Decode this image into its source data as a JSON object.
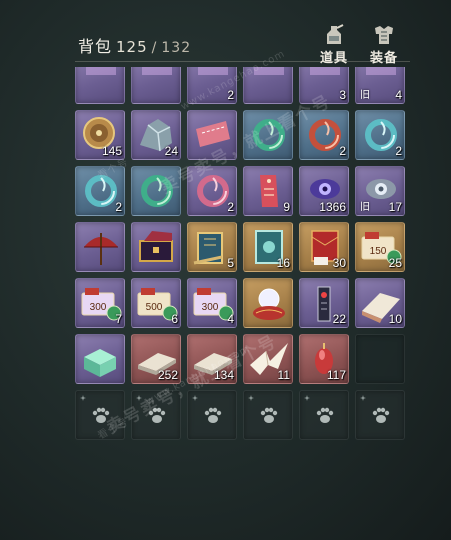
{
  "header": {
    "title": "背包",
    "count": "125",
    "capacity": "132",
    "tabs": [
      {
        "label": "道具",
        "icon": "bottle-icon"
      },
      {
        "label": "装备",
        "icon": "armor-icon"
      }
    ]
  },
  "watermark": {
    "line1": "卖号卖号，就上看个号",
    "url": "www.kangehao.com",
    "small": "看个号"
  },
  "colors": {
    "purple": "#6b5e92",
    "blue": "#4e6e88",
    "gold": "#a47e48",
    "red": "#8c5252"
  },
  "slots": [
    {
      "rarity": "purple",
      "icon": "partial-item-icon",
      "qty": "",
      "old": ""
    },
    {
      "rarity": "purple",
      "icon": "partial-item-icon",
      "qty": "",
      "old": ""
    },
    {
      "rarity": "purple",
      "icon": "partial-item-icon",
      "qty": "2",
      "old": ""
    },
    {
      "rarity": "purple",
      "icon": "partial-item-icon",
      "qty": "",
      "old": ""
    },
    {
      "rarity": "purple",
      "icon": "partial-item-icon",
      "qty": "3",
      "old": ""
    },
    {
      "rarity": "purple",
      "icon": "partial-item-icon",
      "qty": "4",
      "old": "旧"
    },
    {
      "rarity": "purple",
      "icon": "compass-icon",
      "qty": "145",
      "old": ""
    },
    {
      "rarity": "purple",
      "icon": "ore-icon",
      "qty": "24",
      "old": ""
    },
    {
      "rarity": "purple",
      "icon": "ticket-icon",
      "qty": "",
      "old": ""
    },
    {
      "rarity": "blue",
      "icon": "green-ring-icon",
      "qty": "",
      "old": ""
    },
    {
      "rarity": "blue",
      "icon": "red-ring-icon",
      "qty": "2",
      "old": ""
    },
    {
      "rarity": "blue",
      "icon": "cyan-ring-icon",
      "qty": "2",
      "old": ""
    },
    {
      "rarity": "blue",
      "icon": "cyan-ring-icon",
      "qty": "2",
      "old": ""
    },
    {
      "rarity": "blue",
      "icon": "green-ring-icon",
      "qty": "",
      "old": ""
    },
    {
      "rarity": "purple",
      "icon": "pink-ring-icon",
      "qty": "2",
      "old": ""
    },
    {
      "rarity": "purple",
      "icon": "tag-icon",
      "qty": "9",
      "old": ""
    },
    {
      "rarity": "purple",
      "icon": "eye-orb-icon",
      "qty": "1366",
      "old": ""
    },
    {
      "rarity": "purple",
      "icon": "silver-orb-icon",
      "qty": "17",
      "old": "旧"
    },
    {
      "rarity": "purple",
      "icon": "umbrella-icon",
      "qty": "",
      "old": ""
    },
    {
      "rarity": "purple",
      "icon": "chest-icon",
      "qty": "",
      "old": ""
    },
    {
      "rarity": "gold",
      "icon": "scroll-book-icon",
      "qty": "5",
      "old": ""
    },
    {
      "rarity": "gold",
      "icon": "jade-book-icon",
      "qty": "16",
      "old": ""
    },
    {
      "rarity": "gold",
      "icon": "red-envelope-icon",
      "qty": "30",
      "old": ""
    },
    {
      "rarity": "gold",
      "icon": "coupon-150-icon",
      "qty": "25",
      "old": ""
    },
    {
      "rarity": "purple",
      "icon": "coupon-300-icon",
      "qty": "7",
      "old": ""
    },
    {
      "rarity": "purple",
      "icon": "coupon-500-icon",
      "qty": "6",
      "old": ""
    },
    {
      "rarity": "purple",
      "icon": "coupon-300-icon",
      "qty": "4",
      "old": ""
    },
    {
      "rarity": "gold",
      "icon": "crystal-ball-icon",
      "qty": "",
      "old": ""
    },
    {
      "rarity": "purple",
      "icon": "talisman-icon",
      "qty": "22",
      "old": ""
    },
    {
      "rarity": "purple",
      "icon": "folded-paper-icon",
      "qty": "10",
      "old": ""
    },
    {
      "rarity": "purple",
      "icon": "jade-box-icon",
      "qty": "",
      "old": ""
    },
    {
      "rarity": "red",
      "icon": "paper-stack-icon",
      "qty": "252",
      "old": ""
    },
    {
      "rarity": "red",
      "icon": "paper-stack-icon",
      "qty": "134",
      "old": ""
    },
    {
      "rarity": "red",
      "icon": "paper-crane-icon",
      "qty": "11",
      "old": ""
    },
    {
      "rarity": "red",
      "icon": "red-charm-icon",
      "qty": "117",
      "old": ""
    },
    {
      "rarity": "empty",
      "icon": "",
      "qty": "",
      "old": ""
    },
    {
      "rarity": "locked",
      "icon": "paw-icon",
      "qty": "",
      "old": ""
    },
    {
      "rarity": "locked",
      "icon": "paw-icon",
      "qty": "",
      "old": ""
    },
    {
      "rarity": "locked",
      "icon": "paw-icon",
      "qty": "",
      "old": ""
    },
    {
      "rarity": "locked",
      "icon": "paw-icon",
      "qty": "",
      "old": ""
    },
    {
      "rarity": "locked",
      "icon": "paw-icon",
      "qty": "",
      "old": ""
    },
    {
      "rarity": "locked",
      "icon": "paw-icon",
      "qty": "",
      "old": ""
    }
  ]
}
